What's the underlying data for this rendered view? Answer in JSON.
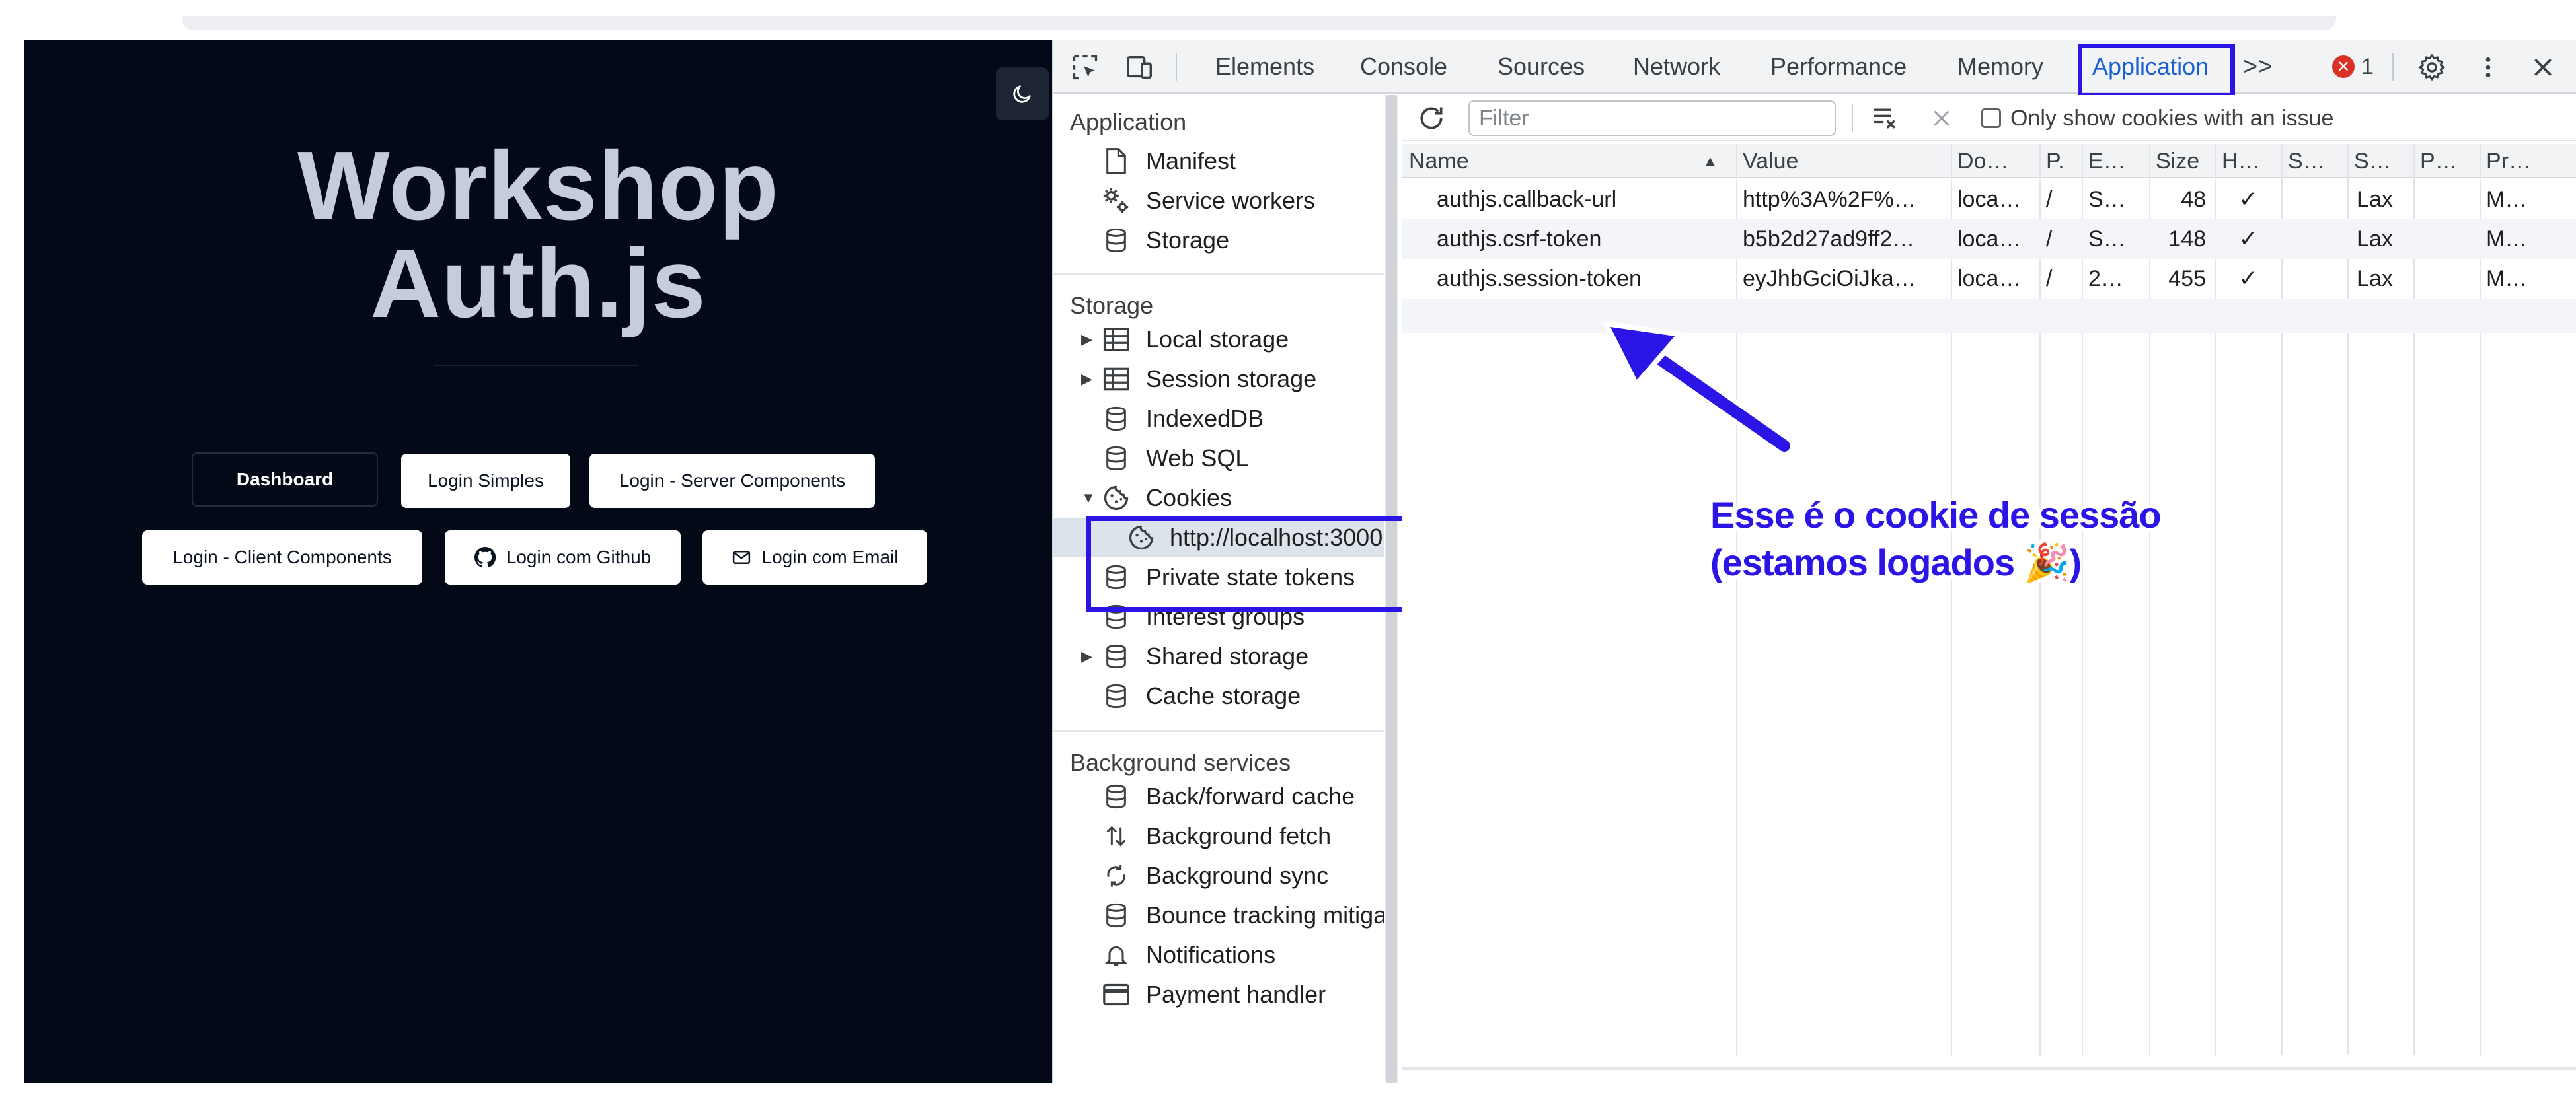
{
  "webpage": {
    "title_line1": "Workshop",
    "title_line2": "Auth.js",
    "buttons": {
      "dashboard": "Dashboard",
      "login_simples": "Login Simples",
      "login_server": "Login - Server Components",
      "login_client": "Login - Client Components",
      "login_github": "Login com Github",
      "login_email": "Login com Email"
    }
  },
  "devtools": {
    "tabs": [
      "Elements",
      "Console",
      "Sources",
      "Network",
      "Performance",
      "Memory",
      "Application"
    ],
    "active_tab": "Application",
    "more_tabs": ">>",
    "error_count": "1",
    "sidebar": {
      "application_header": "Application",
      "application_items": [
        "Manifest",
        "Service workers",
        "Storage"
      ],
      "storage_header": "Storage",
      "storage_items": [
        "Local storage",
        "Session storage",
        "IndexedDB",
        "Web SQL",
        "Cookies",
        "http://localhost:3000",
        "Private state tokens",
        "Interest groups",
        "Shared storage",
        "Cache storage"
      ],
      "background_header": "Background services",
      "background_items": [
        "Back/forward cache",
        "Background fetch",
        "Background sync",
        "Bounce tracking mitigations",
        "Notifications",
        "Payment handler"
      ]
    },
    "cookies": {
      "filter_placeholder": "Filter",
      "only_issue_label": "Only show cookies with an issue",
      "columns": [
        "Name",
        "Value",
        "Do…",
        "P.",
        "E…",
        "Size",
        "H…",
        "S…",
        "S…",
        "P…",
        "Pr…"
      ],
      "rows": [
        {
          "name": "authjs.callback-url",
          "value": "http%3A%2F%…",
          "domain": "loca…",
          "path": "/",
          "expires": "S…",
          "size": "48",
          "httponly": "✓",
          "secure": "",
          "samesite": "Lax",
          "partition": "",
          "priority": "M…"
        },
        {
          "name": "authjs.csrf-token",
          "value": "b5b2d27ad9ff2…",
          "domain": "loca…",
          "path": "/",
          "expires": "S…",
          "size": "148",
          "httponly": "✓",
          "secure": "",
          "samesite": "Lax",
          "partition": "",
          "priority": "M…"
        },
        {
          "name": "authjs.session-token",
          "value": "eyJhbGciOiJka…",
          "domain": "loca…",
          "path": "/",
          "expires": "2…",
          "size": "455",
          "httponly": "✓",
          "secure": "",
          "samesite": "Lax",
          "partition": "",
          "priority": "M…"
        }
      ]
    }
  },
  "annotation": {
    "line1": "Esse é o cookie de sessão",
    "line2": "(estamos logados 🎉)"
  },
  "colors": {
    "page_bg": "#030917",
    "annotation": "#2a14e6",
    "active_tab": "#1a5fd1"
  }
}
